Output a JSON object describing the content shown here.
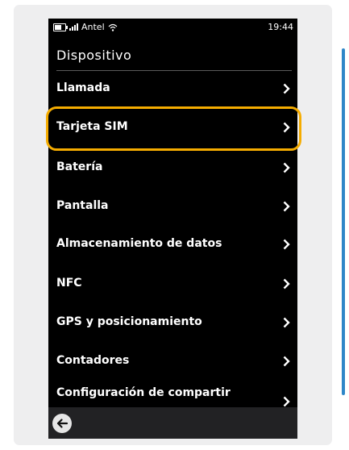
{
  "status_bar": {
    "carrier": "Antel",
    "time": "19:44",
    "icons": [
      "battery-icon",
      "signal-icon",
      "wifi-icon"
    ]
  },
  "page": {
    "title": "Dispositivo"
  },
  "menu": {
    "items": [
      {
        "label": "Llamada"
      },
      {
        "label": "Tarjeta SIM"
      },
      {
        "label": "Batería"
      },
      {
        "label": "Pantalla"
      },
      {
        "label": "Almacenamiento de datos"
      },
      {
        "label": "NFC"
      },
      {
        "label": "GPS y posicionamiento"
      },
      {
        "label": "Contadores"
      },
      {
        "label": "Configuración de compartir"
      }
    ]
  },
  "highlighted_item": "Tarjeta SIM",
  "colors": {
    "highlight": "#f5ac00",
    "accent": "#2e86c8",
    "background": "#000000"
  },
  "bottom_bar": {
    "back_icon": "arrow-left-icon"
  }
}
